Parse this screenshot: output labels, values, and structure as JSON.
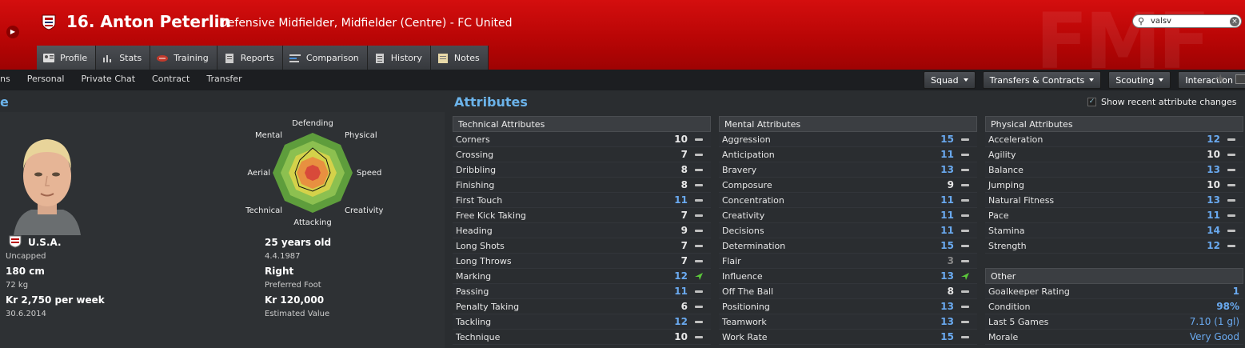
{
  "header": {
    "player_title": "16. Anton Peterlin",
    "subtitle": "Defensive Midfielder, Midfielder (Centre) - FC United",
    "search_value": "valsv",
    "watermark": "FMF"
  },
  "tabs": [
    {
      "label": "Profile",
      "icon": "profile-icon"
    },
    {
      "label": "Stats",
      "icon": "stats-icon"
    },
    {
      "label": "Training",
      "icon": "training-icon"
    },
    {
      "label": "Reports",
      "icon": "reports-icon"
    },
    {
      "label": "Comparison",
      "icon": "comparison-icon"
    },
    {
      "label": "History",
      "icon": "history-icon"
    },
    {
      "label": "Notes",
      "icon": "notes-icon"
    }
  ],
  "subnav": [
    "ns",
    "Personal",
    "Private Chat",
    "Contract",
    "Transfer"
  ],
  "action_buttons": [
    "Squad",
    "Transfers & Contracts",
    "Scouting",
    "Interaction"
  ],
  "left": {
    "title": "e",
    "radar_labels": [
      "Defending",
      "Physical",
      "Speed",
      "Creativity",
      "Attacking",
      "Technical",
      "Aerial",
      "Mental"
    ],
    "nation": "U.S.A.",
    "caps": "Uncapped",
    "height": "180 cm",
    "weight": "72 kg",
    "wage": "Kr 2,750 per week",
    "contract_end": "30.6.2014",
    "age": "25 years old",
    "dob": "4.4.1987",
    "foot": "Right",
    "foot_label": "Preferred Foot",
    "value": "Kr 120,000",
    "value_label": "Estimated Value"
  },
  "attributes": {
    "title": "Attributes",
    "show_recent_label": "Show recent attribute changes",
    "show_recent_checked": true,
    "technical": {
      "header": "Technical Attributes",
      "rows": [
        {
          "name": "Corners",
          "value": "10",
          "trend": "dash"
        },
        {
          "name": "Crossing",
          "value": "7",
          "trend": "dash"
        },
        {
          "name": "Dribbling",
          "value": "8",
          "trend": "dash"
        },
        {
          "name": "Finishing",
          "value": "8",
          "trend": "dash"
        },
        {
          "name": "First Touch",
          "value": "11",
          "trend": "dash"
        },
        {
          "name": "Free Kick Taking",
          "value": "7",
          "trend": "dash"
        },
        {
          "name": "Heading",
          "value": "9",
          "trend": "dash"
        },
        {
          "name": "Long Shots",
          "value": "7",
          "trend": "dash"
        },
        {
          "name": "Long Throws",
          "value": "7",
          "trend": "dash"
        },
        {
          "name": "Marking",
          "value": "12",
          "trend": "up"
        },
        {
          "name": "Passing",
          "value": "11",
          "trend": "dash"
        },
        {
          "name": "Penalty Taking",
          "value": "6",
          "trend": "dash"
        },
        {
          "name": "Tackling",
          "value": "12",
          "trend": "dash"
        },
        {
          "name": "Technique",
          "value": "10",
          "trend": "dash"
        }
      ]
    },
    "mental": {
      "header": "Mental Attributes",
      "rows": [
        {
          "name": "Aggression",
          "value": "15",
          "trend": "dash"
        },
        {
          "name": "Anticipation",
          "value": "11",
          "trend": "dash"
        },
        {
          "name": "Bravery",
          "value": "13",
          "trend": "dash"
        },
        {
          "name": "Composure",
          "value": "9",
          "trend": "dash"
        },
        {
          "name": "Concentration",
          "value": "11",
          "trend": "dash"
        },
        {
          "name": "Creativity",
          "value": "11",
          "trend": "dash"
        },
        {
          "name": "Decisions",
          "value": "11",
          "trend": "dash"
        },
        {
          "name": "Determination",
          "value": "15",
          "trend": "dash"
        },
        {
          "name": "Flair",
          "value": "3",
          "trend": "dash"
        },
        {
          "name": "Influence",
          "value": "13",
          "trend": "up"
        },
        {
          "name": "Off The Ball",
          "value": "8",
          "trend": "dash"
        },
        {
          "name": "Positioning",
          "value": "13",
          "trend": "dash"
        },
        {
          "name": "Teamwork",
          "value": "13",
          "trend": "dash"
        },
        {
          "name": "Work Rate",
          "value": "15",
          "trend": "dash"
        }
      ]
    },
    "physical": {
      "header": "Physical Attributes",
      "rows": [
        {
          "name": "Acceleration",
          "value": "12",
          "trend": "dash"
        },
        {
          "name": "Agility",
          "value": "10",
          "trend": "dash"
        },
        {
          "name": "Balance",
          "value": "13",
          "trend": "dash"
        },
        {
          "name": "Jumping",
          "value": "10",
          "trend": "dash"
        },
        {
          "name": "Natural Fitness",
          "value": "13",
          "trend": "dash"
        },
        {
          "name": "Pace",
          "value": "11",
          "trend": "dash"
        },
        {
          "name": "Stamina",
          "value": "14",
          "trend": "dash"
        },
        {
          "name": "Strength",
          "value": "12",
          "trend": "dash"
        }
      ]
    },
    "other": {
      "header": "Other",
      "rows": [
        {
          "name": "Goalkeeper Rating",
          "value": "1",
          "bold": true
        },
        {
          "name": "Condition",
          "value": "98%",
          "bold": true
        },
        {
          "name": "Last 5 Games",
          "value": "7.10 (1 gl)",
          "bold": false
        },
        {
          "name": "Morale",
          "value": "Very Good",
          "bold": false
        }
      ]
    }
  },
  "colors": {
    "header_red": "#c80a0a",
    "accent_blue": "#6bb3ea",
    "trend_up_green": "#5bc83a"
  }
}
